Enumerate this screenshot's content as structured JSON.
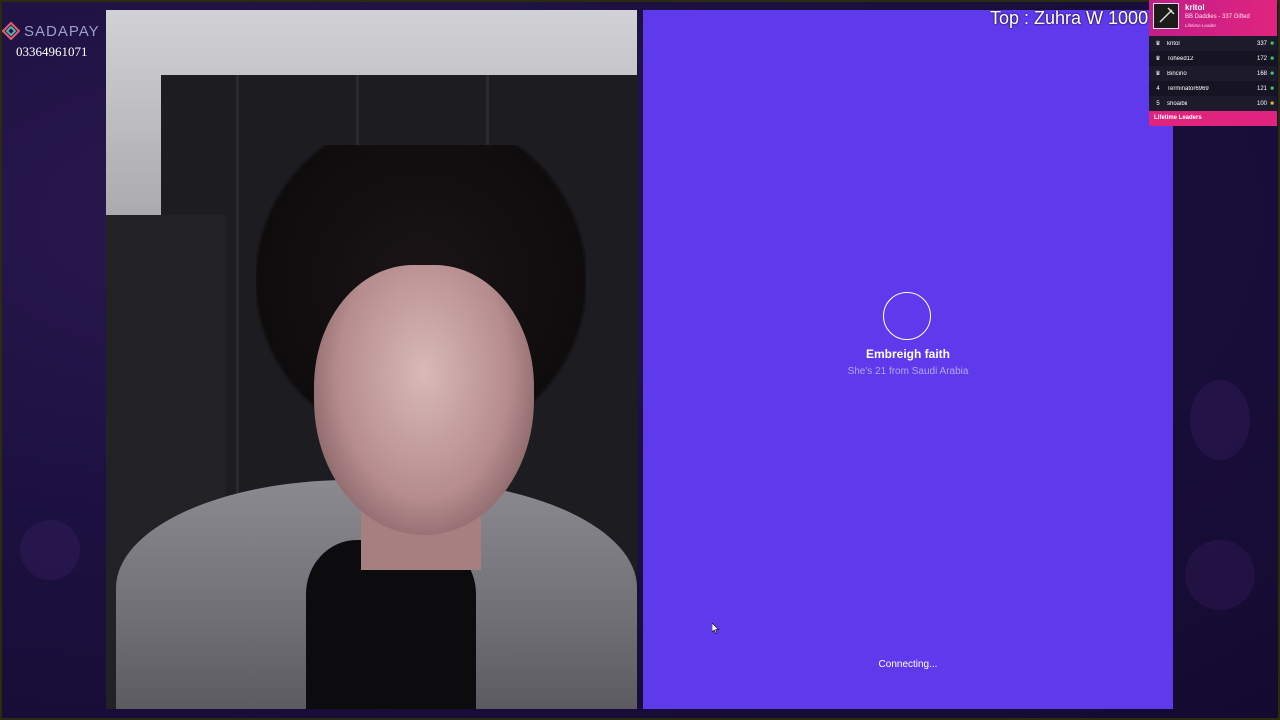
{
  "branding": {
    "name": "SADAPAY",
    "phone": "03364961071"
  },
  "top_gifter": {
    "text": "Top : Zuhra W 1000"
  },
  "leaderboard": {
    "header": {
      "name": "kritol",
      "subtitle": "BB Daddies - 337 Gifted",
      "tag": "Lifetime Leader"
    },
    "rows": [
      {
        "rank": "",
        "user": "kritol",
        "count": "337"
      },
      {
        "rank": "",
        "user": "Toheed12",
        "count": "172"
      },
      {
        "rank": "",
        "user": "Bincino",
        "count": "168"
      },
      {
        "rank": "4",
        "user": "Terminator6969",
        "count": "121"
      },
      {
        "rank": "5",
        "user": "shoaibii",
        "count": "100"
      }
    ],
    "footer": "Lifetime Leaders",
    "colors": {
      "accent": "#e0247e",
      "gift_green": "#3ccf6a",
      "gift_gold": "#e9c03a"
    }
  },
  "call": {
    "name": "Embreigh faith",
    "subtitle": "She's 21 from Saudi Arabia",
    "status": "Connecting...",
    "background": "#5f3aed"
  }
}
